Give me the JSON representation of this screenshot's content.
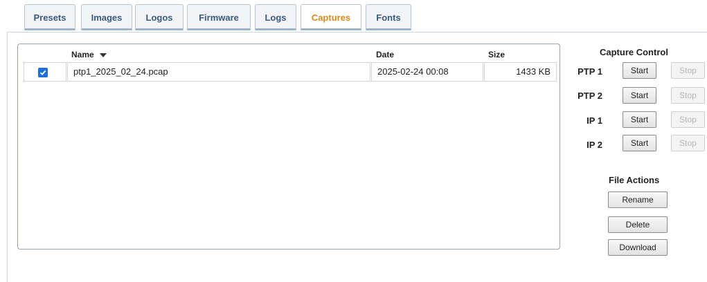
{
  "tabs": [
    {
      "label": "Presets"
    },
    {
      "label": "Images"
    },
    {
      "label": "Logos"
    },
    {
      "label": "Firmware"
    },
    {
      "label": "Logs"
    },
    {
      "label": "Captures",
      "active": true
    },
    {
      "label": "Fonts"
    }
  ],
  "table": {
    "columns": {
      "name": "Name",
      "date": "Date",
      "size": "Size"
    },
    "sort": {
      "column": "Name",
      "direction": "descending",
      "icon": "sort-down-arrow-icon"
    },
    "rows": [
      {
        "checked": true,
        "name": "ptp1_2025_02_24.pcap",
        "date": "2025-02-24 00:08",
        "size": "1433 KB"
      }
    ]
  },
  "capture_control": {
    "title": "Capture Control",
    "start_label": "Start",
    "stop_label": "Stop",
    "channels": [
      {
        "label": "PTP 1"
      },
      {
        "label": "PTP 2"
      },
      {
        "label": "IP 1"
      },
      {
        "label": "IP 2"
      }
    ]
  },
  "file_actions": {
    "title": "File Actions",
    "rename_label": "Rename",
    "delete_label": "Delete",
    "download_label": "Download"
  },
  "colors": {
    "active_tab_text": "#d88a1a",
    "tab_text": "#3a5a80",
    "checkbox_blue": "#1f6fd6"
  }
}
